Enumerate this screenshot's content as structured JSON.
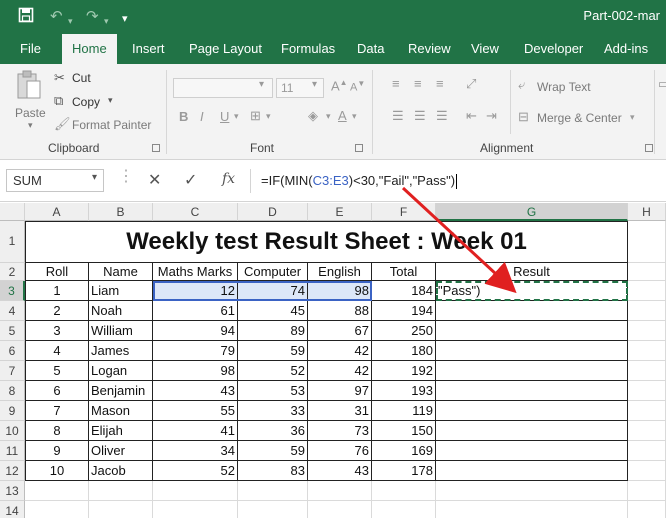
{
  "app": {
    "file_title": "Part-002-mar"
  },
  "quick_access": {
    "customize_glyph": "▾"
  },
  "ribbon_tabs": [
    "File",
    "Home",
    "Insert",
    "Page Layout",
    "Formulas",
    "Data",
    "Review",
    "View",
    "Developer",
    "Add-ins"
  ],
  "ribbon": {
    "clipboard": {
      "paste": "Paste",
      "cut": "Cut",
      "copy": "Copy",
      "format_painter": "Format Painter",
      "label": "Clipboard"
    },
    "font": {
      "size": "11",
      "bold": "B",
      "italic": "I",
      "underline": "U",
      "label": "Font"
    },
    "alignment": {
      "wrap_text": "Wrap Text",
      "merge_center": "Merge & Center",
      "label": "Alignment"
    }
  },
  "formula_bar": {
    "name_box": "SUM",
    "fx": "fx",
    "formula_pre": "=IF(MIN(",
    "formula_ref": "C3:E3",
    "formula_post": ")<30,\"Fail\",\"Pass\")"
  },
  "columns": [
    "A",
    "B",
    "C",
    "D",
    "E",
    "F",
    "G",
    "H"
  ],
  "row_numbers": [
    "1",
    "2",
    "3",
    "4",
    "5",
    "6",
    "7",
    "8",
    "9",
    "10",
    "11",
    "12",
    "13",
    "14"
  ],
  "sheet": {
    "title": "Weekly test Result Sheet : Week 01",
    "headers": [
      "Roll",
      "Name",
      "Maths Marks",
      "Computer",
      "English",
      "Total",
      "Result"
    ],
    "rows": [
      {
        "roll": "1",
        "name": "Liam",
        "maths": "12",
        "computer": "74",
        "english": "98",
        "total": "184",
        "result": "\"Pass\")"
      },
      {
        "roll": "2",
        "name": "Noah",
        "maths": "61",
        "computer": "45",
        "english": "88",
        "total": "194",
        "result": ""
      },
      {
        "roll": "3",
        "name": "William",
        "maths": "94",
        "computer": "89",
        "english": "67",
        "total": "250",
        "result": ""
      },
      {
        "roll": "4",
        "name": "James",
        "maths": "79",
        "computer": "59",
        "english": "42",
        "total": "180",
        "result": ""
      },
      {
        "roll": "5",
        "name": "Logan",
        "maths": "98",
        "computer": "52",
        "english": "42",
        "total": "192",
        "result": ""
      },
      {
        "roll": "6",
        "name": "Benjamin",
        "maths": "43",
        "computer": "53",
        "english": "97",
        "total": "193",
        "result": ""
      },
      {
        "roll": "7",
        "name": "Mason",
        "maths": "55",
        "computer": "33",
        "english": "31",
        "total": "119",
        "result": ""
      },
      {
        "roll": "8",
        "name": "Elijah",
        "maths": "41",
        "computer": "36",
        "english": "73",
        "total": "150",
        "result": ""
      },
      {
        "roll": "9",
        "name": "Oliver",
        "maths": "34",
        "computer": "59",
        "english": "76",
        "total": "169",
        "result": ""
      },
      {
        "roll": "10",
        "name": "Jacob",
        "maths": "52",
        "computer": "83",
        "english": "43",
        "total": "178",
        "result": ""
      }
    ]
  },
  "colors": {
    "excel_green": "#217346",
    "arrow_red": "#e02020",
    "selection_blue": "#3b63c4",
    "active_green": "#217346"
  }
}
